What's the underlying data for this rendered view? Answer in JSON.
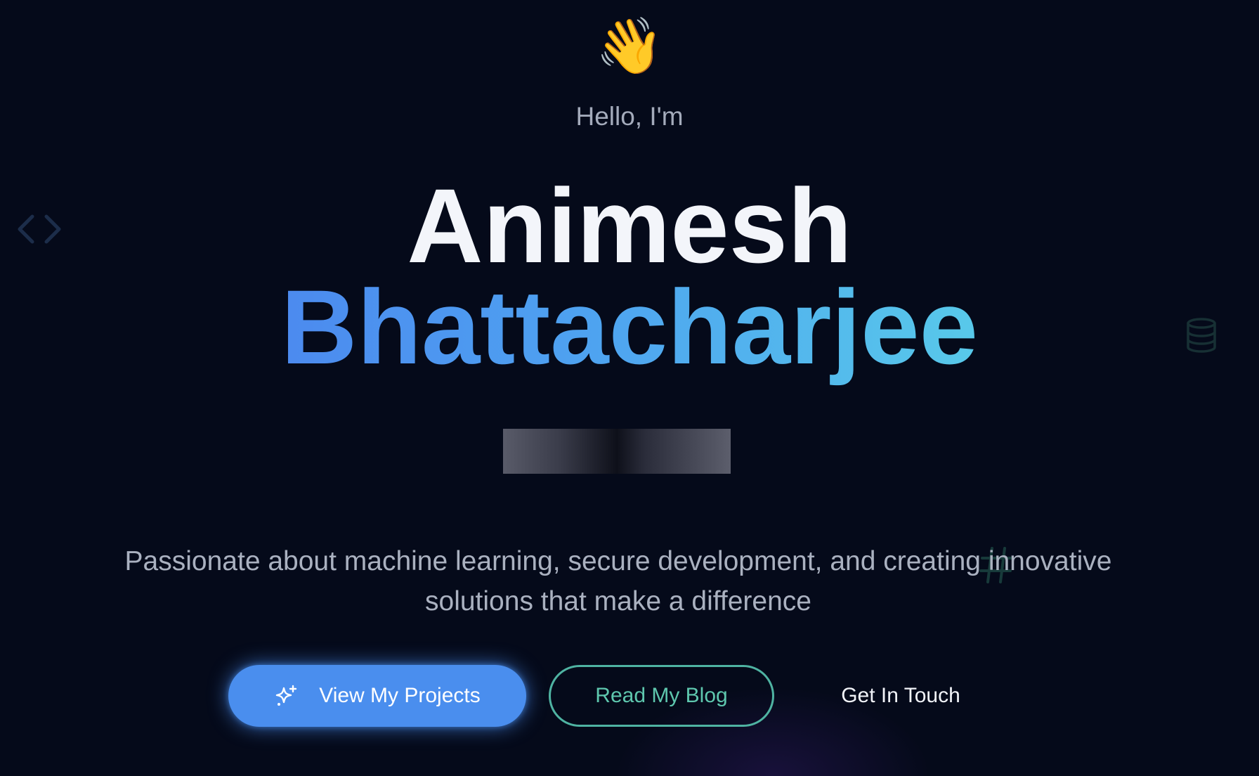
{
  "hero": {
    "wave_emoji": "👋",
    "greeting": "Hello, I'm",
    "first_name": "Animesh",
    "last_name": "Bhattacharjee",
    "tagline_line1": "Passionate about machine learning, secure development, and creating innovative",
    "tagline_line2": "solutions that make a difference"
  },
  "buttons": {
    "primary_label": "View My Projects",
    "primary_icon": "sparkles-icon",
    "secondary_label": "Read My Blog",
    "tertiary_label": "Get In Touch"
  },
  "decorations": {
    "left_icon": "code-icon",
    "right_icon": "database-icon",
    "tagline_icon": "hash-icon"
  },
  "colors": {
    "background": "#050a1a",
    "accent_blue": "#4a8eee",
    "accent_teal": "#4fb3a2",
    "gradient_start": "#4c8aef",
    "gradient_end": "#58c9ea"
  }
}
